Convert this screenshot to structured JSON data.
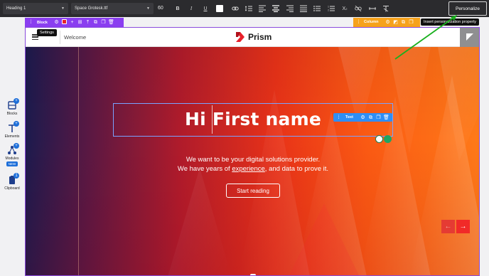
{
  "toolbar": {
    "text_style": "Heading 1",
    "font_family": "Space Grotesk.ttf",
    "font_size": "60",
    "personalize_label": "Personalize",
    "personalize_tooltip": "Insert personalization property"
  },
  "rail": {
    "items": [
      {
        "label": "Blocks",
        "icon": "blocks-icon"
      },
      {
        "label": "Elements",
        "icon": "elements-icon"
      },
      {
        "label": "Modules",
        "icon": "modules-icon",
        "badge": "NEW"
      },
      {
        "label": "Clipboard",
        "icon": "clipboard-icon",
        "count": "1"
      }
    ]
  },
  "selection": {
    "block_label": "Block",
    "block_tooltip": "Settings",
    "column_label": "Column",
    "text_label": "Text"
  },
  "page": {
    "nav_label": "Welcome",
    "brand": "Prism",
    "headline_prefix": "Hi",
    "headline_token": "First name",
    "sub_line1": "We want to be your digital solutions provider.",
    "sub_line2_before": "We have years of ",
    "sub_line2_link": "experience",
    "sub_line2_after": ", and data to prove it.",
    "cta_label": "Start reading"
  },
  "colors": {
    "accent_block": "#8a3ef0",
    "accent_column": "#f6a21b",
    "accent_text": "#2f8ef4",
    "brand_red": "#e8202a"
  }
}
